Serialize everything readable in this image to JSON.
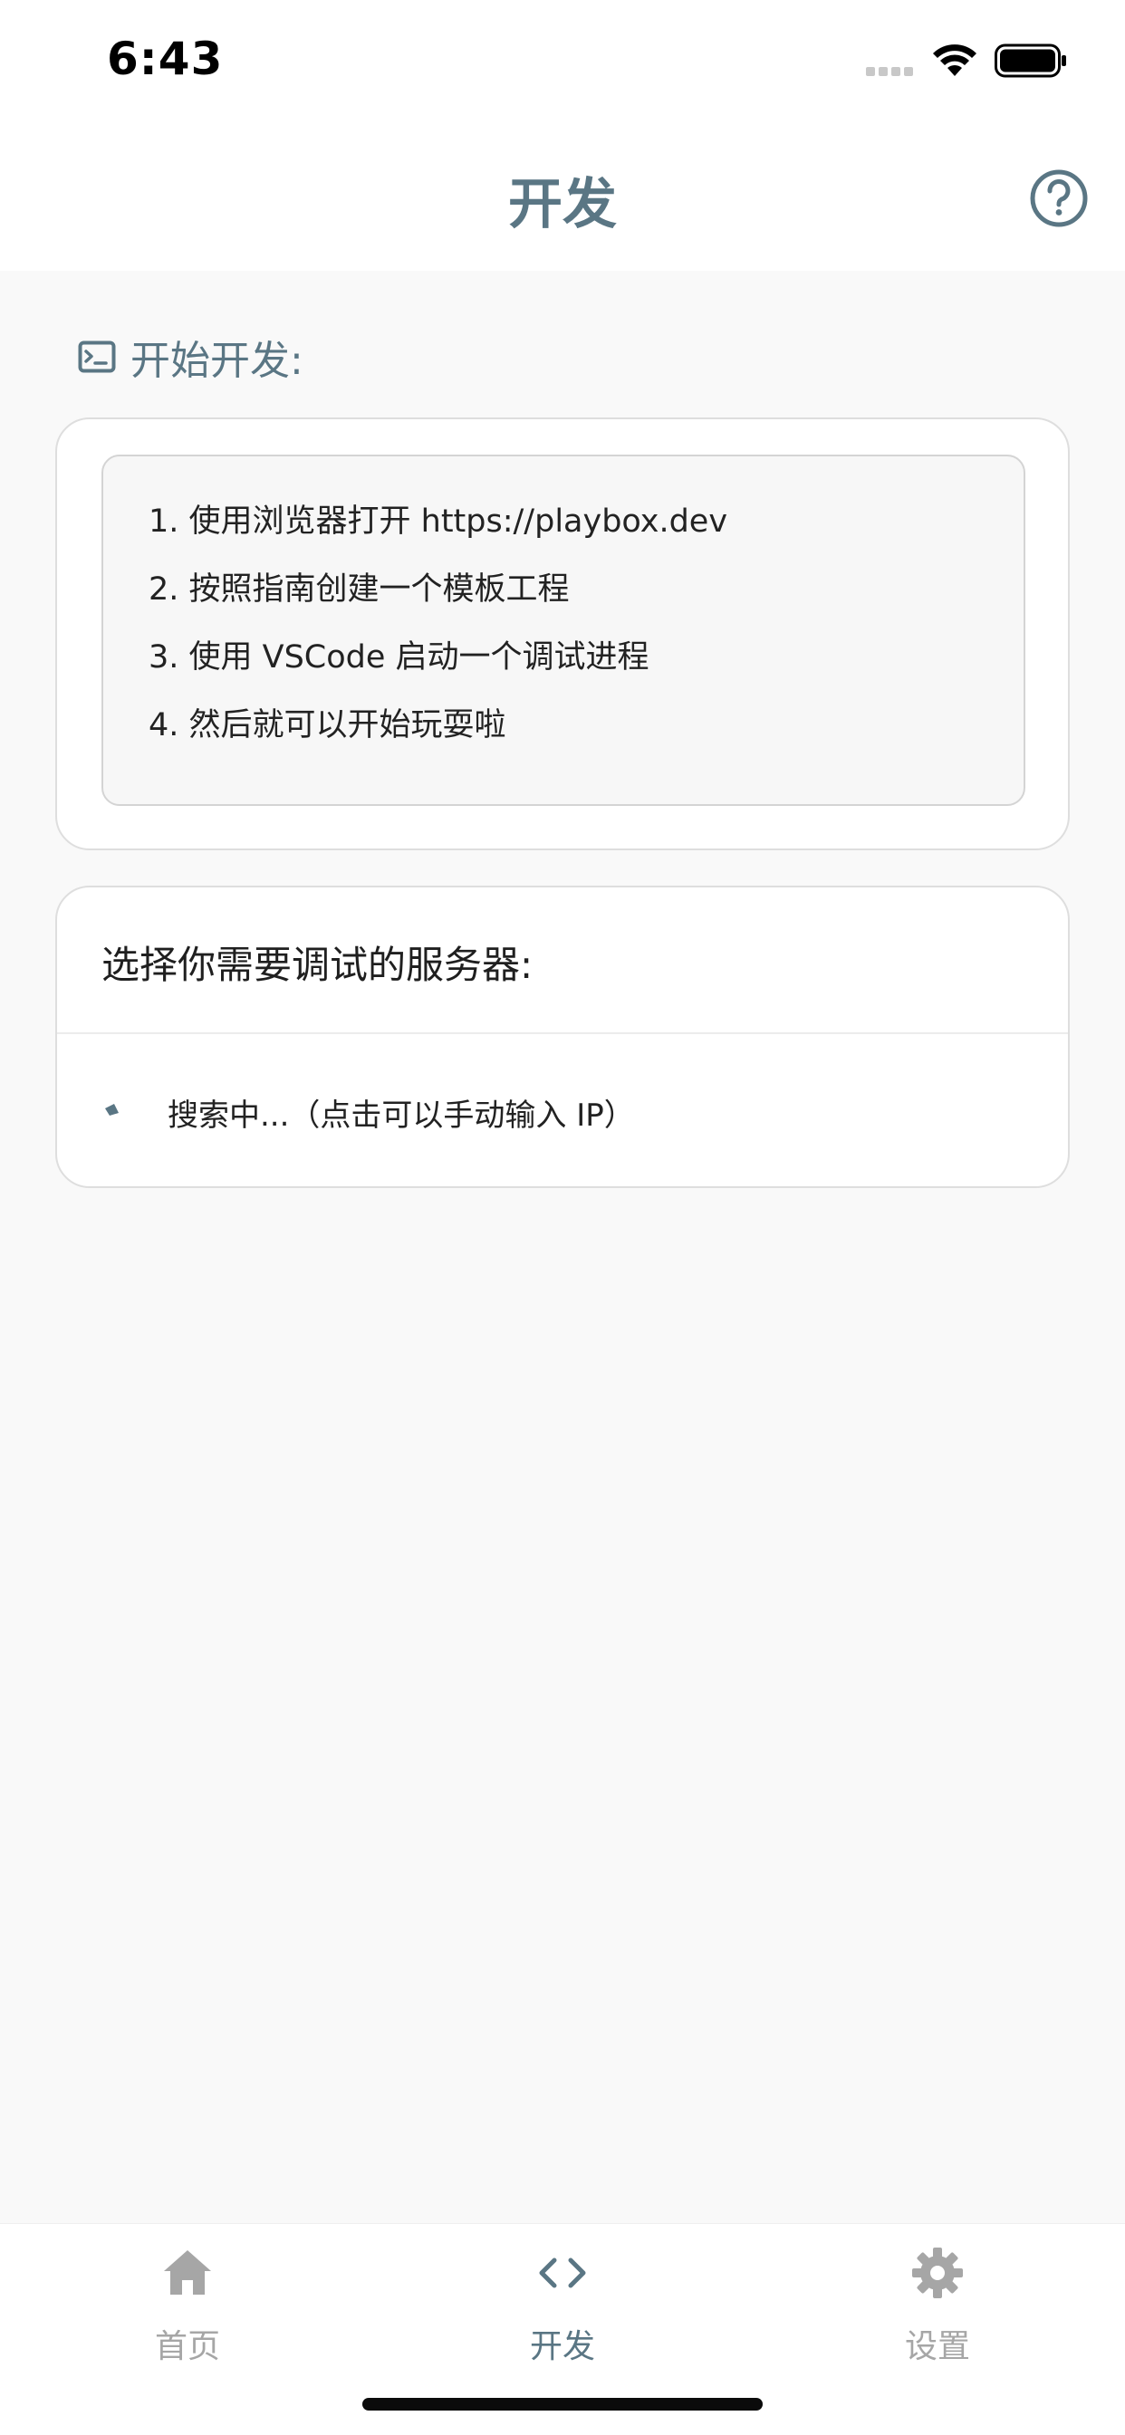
{
  "status_bar": {
    "time": "6:43"
  },
  "header": {
    "title": "开发",
    "help_icon": "question-circle-icon"
  },
  "section": {
    "title": "开始开发:",
    "icon": "terminal-icon"
  },
  "instructions": {
    "steps": [
      "1. 使用浏览器打开 https://playbox.dev",
      "2. 按照指南创建一个模板工程",
      "3. 使用 VSCode 启动一个调试进程",
      "4. 然后就可以开始玩耍啦"
    ]
  },
  "server": {
    "title": "选择你需要调试的服务器:",
    "status": "搜索中...（点击可以手动输入 IP）"
  },
  "tabs": [
    {
      "label": "首页",
      "icon": "home-icon",
      "active": false
    },
    {
      "label": "开发",
      "icon": "code-icon",
      "active": true
    },
    {
      "label": "设置",
      "icon": "gear-icon",
      "active": false
    }
  ],
  "colors": {
    "accent": "#5a7684",
    "inactive": "#a6a6a6",
    "background": "#f9f9f9",
    "card": "#ffffff"
  }
}
